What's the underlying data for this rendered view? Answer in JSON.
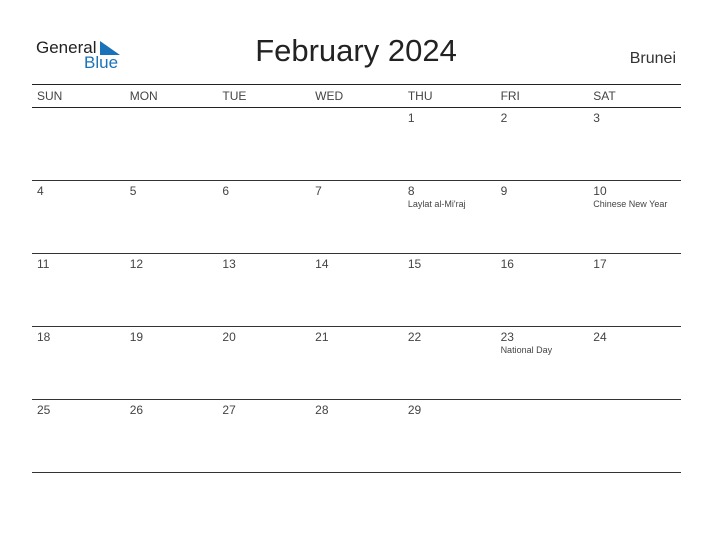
{
  "logo": {
    "line1": "General",
    "line2": "Blue"
  },
  "title": "February 2024",
  "country": "Brunei",
  "days": [
    "SUN",
    "MON",
    "TUE",
    "WED",
    "THU",
    "FRI",
    "SAT"
  ],
  "weeks": [
    [
      {
        "d": ""
      },
      {
        "d": ""
      },
      {
        "d": ""
      },
      {
        "d": ""
      },
      {
        "d": "1"
      },
      {
        "d": "2"
      },
      {
        "d": "3"
      }
    ],
    [
      {
        "d": "4"
      },
      {
        "d": "5"
      },
      {
        "d": "6"
      },
      {
        "d": "7"
      },
      {
        "d": "8",
        "e": "Laylat al-Mi'raj"
      },
      {
        "d": "9"
      },
      {
        "d": "10",
        "e": "Chinese New Year"
      }
    ],
    [
      {
        "d": "11"
      },
      {
        "d": "12"
      },
      {
        "d": "13"
      },
      {
        "d": "14"
      },
      {
        "d": "15"
      },
      {
        "d": "16"
      },
      {
        "d": "17"
      }
    ],
    [
      {
        "d": "18"
      },
      {
        "d": "19"
      },
      {
        "d": "20"
      },
      {
        "d": "21"
      },
      {
        "d": "22"
      },
      {
        "d": "23",
        "e": "National Day"
      },
      {
        "d": "24"
      }
    ],
    [
      {
        "d": "25"
      },
      {
        "d": "26"
      },
      {
        "d": "27"
      },
      {
        "d": "28"
      },
      {
        "d": "29"
      },
      {
        "d": ""
      },
      {
        "d": ""
      }
    ]
  ]
}
